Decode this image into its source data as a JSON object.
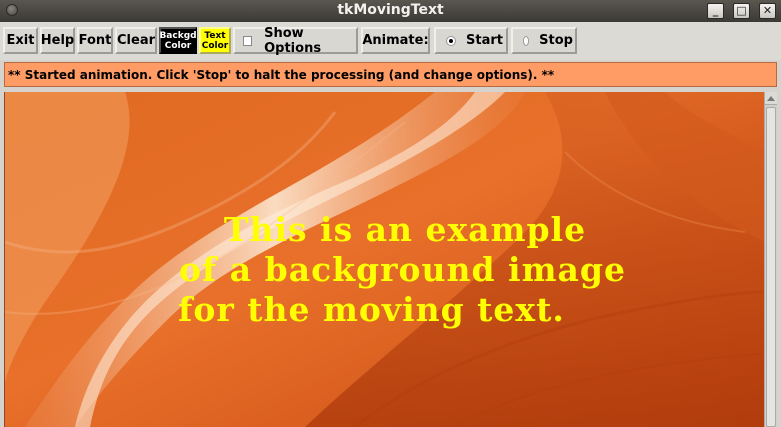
{
  "window": {
    "title": "tkMovingText",
    "minimize_glyph": "_",
    "maximize_glyph": "□",
    "close_glyph": "✕"
  },
  "toolbar": {
    "exit_label": "Exit",
    "help_label": "Help",
    "font_label": "Font",
    "clear_label": "Clear",
    "bg_color_line1": "Backgd",
    "bg_color_line2": "Color",
    "text_color_line1": "Text",
    "text_color_line2": "Color",
    "show_options_label": "Show Options",
    "show_options_checked": false,
    "animate_label": "Animate:",
    "start_label": "Start",
    "stop_label": "Stop",
    "animate_selected": "Start",
    "bg_button_color": "#000000",
    "text_button_color": "#ffff00"
  },
  "message": {
    "text": "** Started animation. Click 'Stop' to halt the processing (and change options). **",
    "background": "#ff9b64"
  },
  "canvas": {
    "text_lines": [
      "This is an example",
      "of a background image",
      "for the moving text."
    ],
    "text_color": "#ffff00",
    "background_image": "orange sandstone canyon wall"
  },
  "icons": {
    "window_menu": "window-menu-icon",
    "scroll_up": "scroll-up-arrow-icon"
  }
}
